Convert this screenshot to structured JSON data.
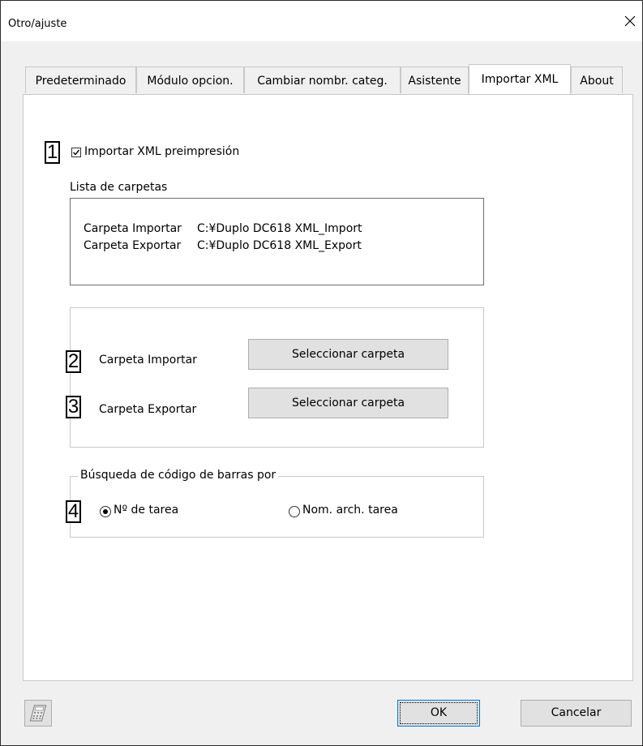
{
  "window": {
    "title": "Otro/ajuste",
    "close_icon": "close-icon"
  },
  "tabs": [
    {
      "label": "Predeterminado",
      "active": false
    },
    {
      "label": "Módulo opcion.",
      "active": false
    },
    {
      "label": "Cambiar nombr. categ.",
      "active": false
    },
    {
      "label": "Asistente",
      "active": false
    },
    {
      "label": "Importar XML",
      "active": true
    },
    {
      "label": "About",
      "active": false
    }
  ],
  "callouts": [
    "1",
    "2",
    "3",
    "4"
  ],
  "import_checkbox": {
    "label": "Importar XML preimpresión",
    "checked": true
  },
  "folder_list": {
    "heading": "Lista de carpetas",
    "rows": [
      {
        "name": "Carpeta Importar",
        "path": "C:¥Duplo DC618 XML_Import"
      },
      {
        "name": "Carpeta Exportar",
        "path": "C:¥Duplo DC618 XML_Export"
      }
    ]
  },
  "folder_select": {
    "import_label": "Carpeta Importar",
    "export_label": "Carpeta Exportar",
    "button_label": "Seleccionar carpeta"
  },
  "barcode_search": {
    "legend": "Búsqueda de código de barras por",
    "options": [
      {
        "label": "Nº de tarea",
        "selected": true
      },
      {
        "label": "Nom. arch. tarea",
        "selected": false
      }
    ]
  },
  "footer": {
    "calculator_icon": "calculator-icon",
    "ok_label": "OK",
    "cancel_label": "Cancelar"
  }
}
